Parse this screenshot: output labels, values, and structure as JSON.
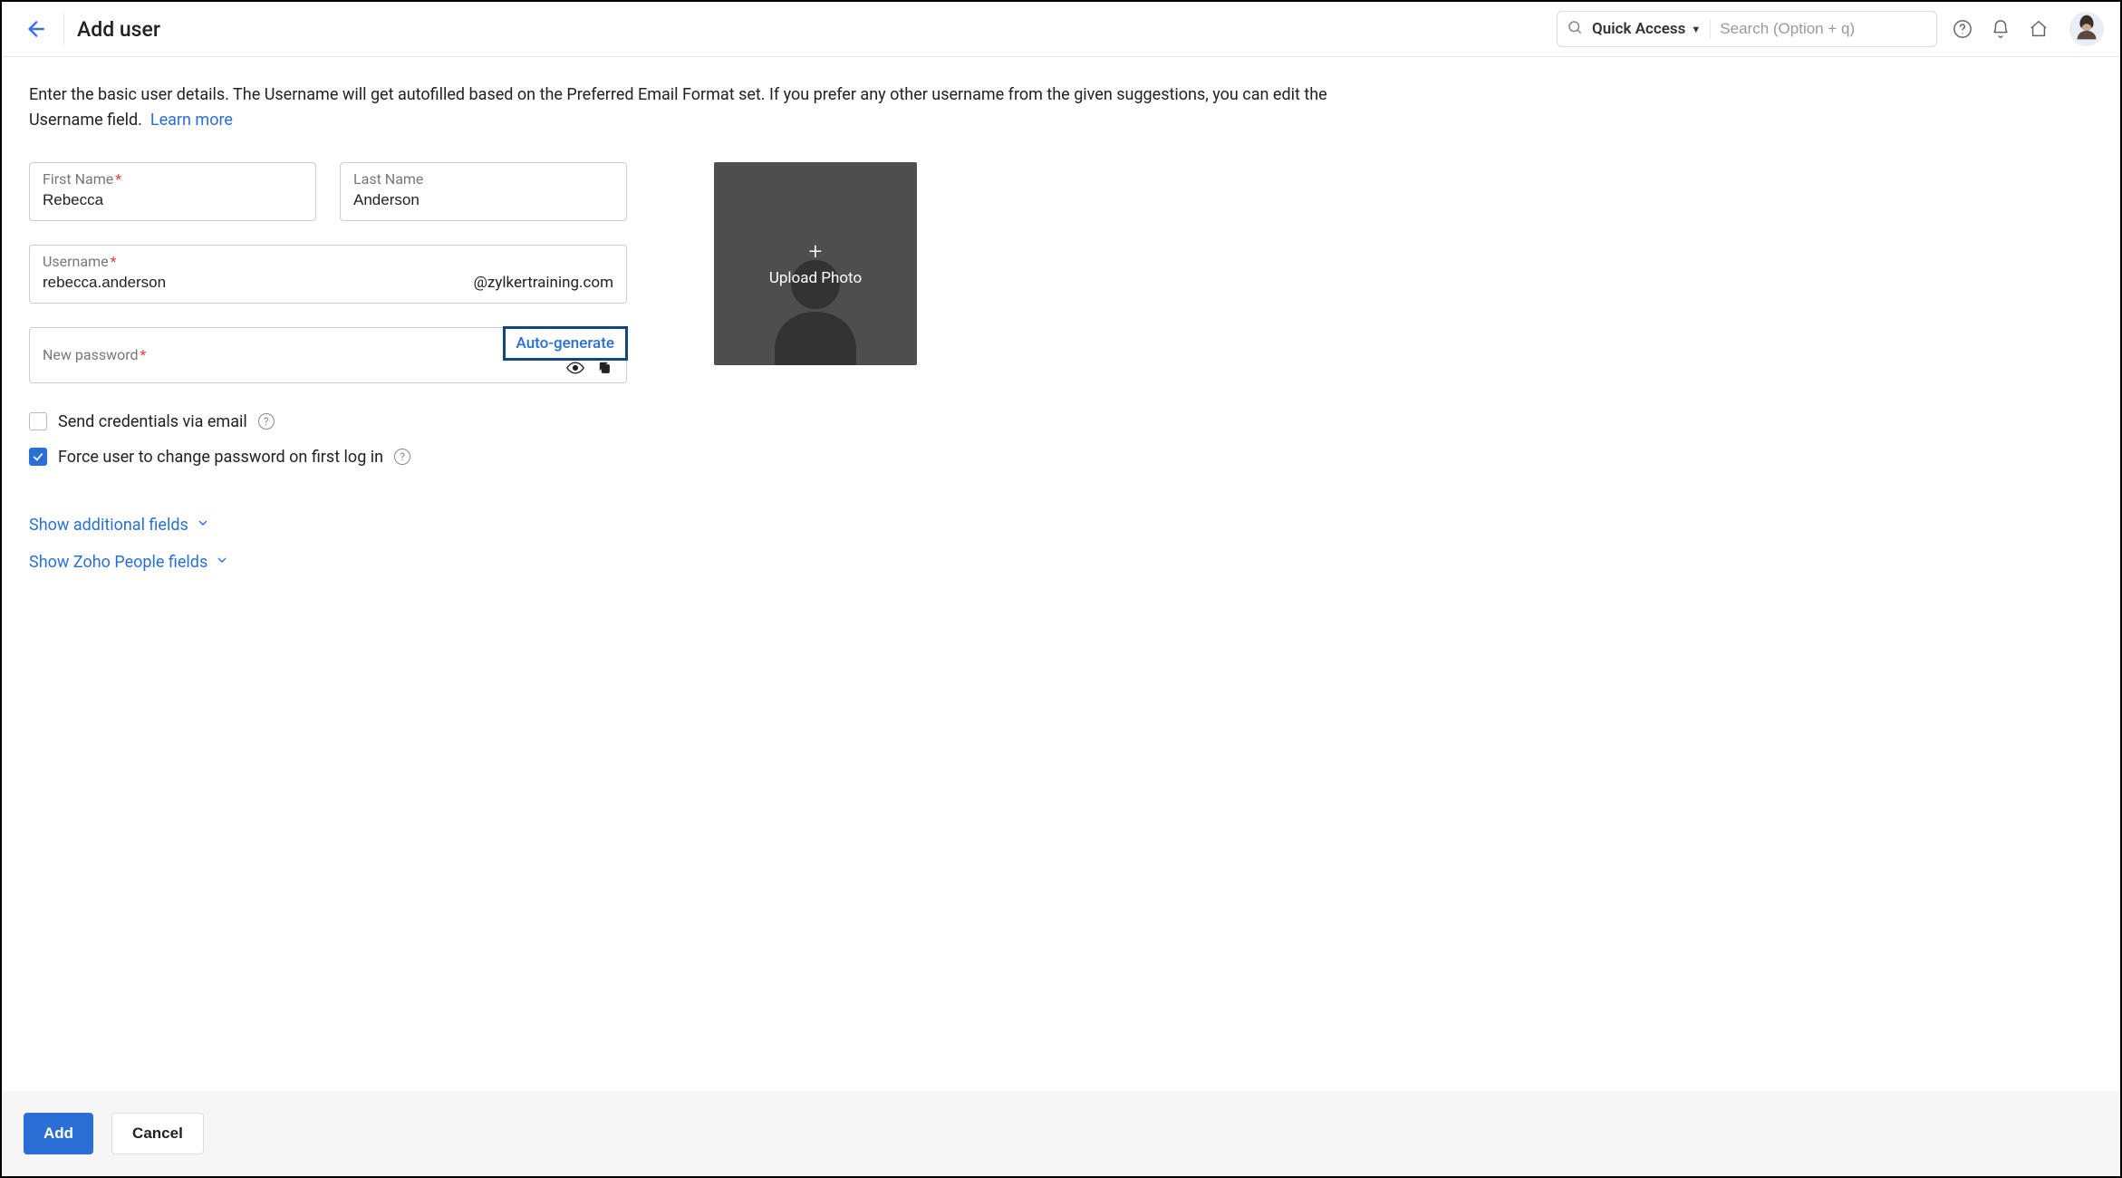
{
  "header": {
    "title": "Add user",
    "quick_access_label": "Quick Access",
    "search_placeholder": "Search (Option + q)"
  },
  "intro": {
    "text": "Enter the basic user details. The Username will get autofilled based on the Preferred Email Format set. If you prefer any other username from the given suggestions, you can edit the Username field.",
    "learn_more": "Learn more"
  },
  "fields": {
    "first_name_label": "First Name",
    "first_name_value": "Rebecca",
    "last_name_label": "Last Name",
    "last_name_value": "Anderson",
    "username_label": "Username",
    "username_value": "rebecca.anderson",
    "domain_suffix": "@zylkertraining.com",
    "password_label": "New password",
    "auto_generate": "Auto-generate"
  },
  "checks": {
    "send_credentials": "Send credentials via email",
    "force_change": "Force user to change password on first log in"
  },
  "links": {
    "show_additional": "Show additional fields",
    "show_people": "Show Zoho People fields"
  },
  "upload": {
    "label": "Upload Photo"
  },
  "footer": {
    "add": "Add",
    "cancel": "Cancel"
  }
}
